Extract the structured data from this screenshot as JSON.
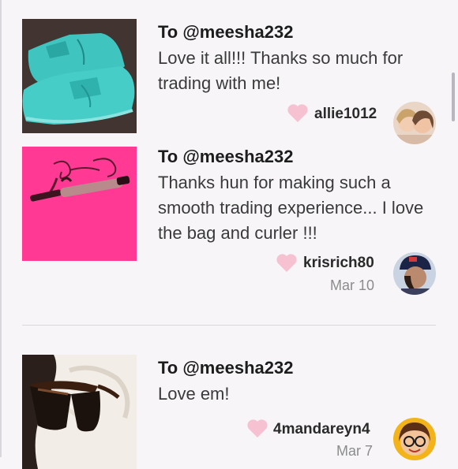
{
  "reviews": [
    {
      "to": "To @meesha232",
      "message": "Love it all!!! Thanks so much for trading with me!",
      "username": "allie1012",
      "date": "",
      "photo": "teal-sneakers",
      "avatar": "two-people-avatar"
    },
    {
      "to": "To @meesha232",
      "message": "Thanks hun for making such a smooth trading experience... I love the bag and curler !!!",
      "username": "krisrich80",
      "date": "Mar 10",
      "photo": "curling-iron-on-pink",
      "avatar": "person-with-cap-avatar"
    },
    {
      "to": "To @meesha232",
      "message": "Love em!",
      "username": "4mandareyn4",
      "date": "Mar 7",
      "photo": "ray-ban-sunglasses",
      "avatar": "cartoon-face-avatar"
    }
  ],
  "colors": {
    "heart": "#f6c1d1",
    "background": "#f7f5f8",
    "divider": "#dad8dc"
  }
}
